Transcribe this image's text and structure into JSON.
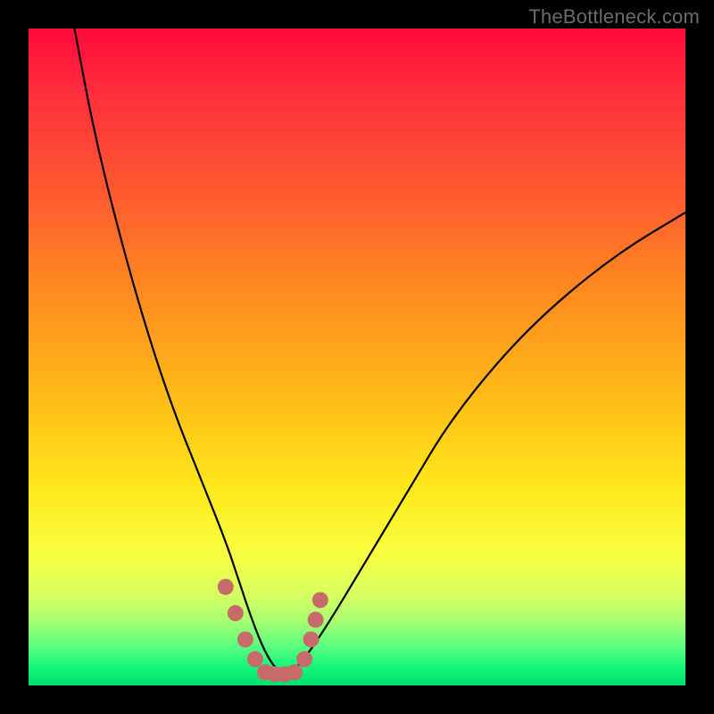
{
  "watermark": "TheBottleneck.com",
  "colors": {
    "background": "#000000",
    "gradient_top": "#ff0a3a",
    "gradient_mid": "#ffe81a",
    "gradient_bottom": "#00e070",
    "curve": "#000000",
    "marker": "#c76a6a"
  },
  "chart_data": {
    "type": "line",
    "title": "",
    "xlabel": "",
    "ylabel": "",
    "xlim": [
      0,
      100
    ],
    "ylim": [
      0,
      100
    ],
    "grid": false,
    "annotations": [
      "TheBottleneck.com"
    ],
    "series": [
      {
        "name": "bottleneck-curve",
        "x": [
          7,
          10,
          14,
          18,
          22,
          26,
          30,
          32,
          34,
          36,
          38,
          40,
          42,
          46,
          52,
          58,
          64,
          72,
          80,
          90,
          100
        ],
        "values": [
          100,
          84,
          68,
          54,
          42,
          32,
          22,
          16,
          10,
          5,
          2,
          2,
          4,
          10,
          20,
          30,
          40,
          50,
          58,
          66,
          72
        ]
      }
    ],
    "markers": [
      {
        "name": "highlight-cluster",
        "x": [
          30,
          31.5,
          33,
          34.5,
          36,
          37.5,
          39,
          40.5,
          42,
          43,
          43.7,
          44.4
        ],
        "values": [
          15,
          11,
          7,
          4,
          2,
          1.7,
          1.7,
          2,
          4,
          7,
          10,
          13
        ]
      }
    ]
  }
}
